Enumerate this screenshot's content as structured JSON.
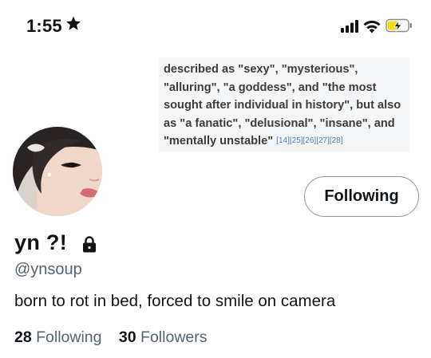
{
  "status_bar": {
    "time": "1:55",
    "icons": [
      "star-icon",
      "cellular-signal-icon",
      "wifi-icon",
      "battery-charging-icon"
    ],
    "battery_color": "#f5d90a"
  },
  "banner": {
    "text": "described as \"sexy\", \"mysterious\", \"alluring\", \"a goddess\", and \"the most sought after individual in history\", but also as \"a fanatic\", \"delusional\", \"insane\", and \"mentally unstable\"",
    "references": "[14][25][26][27][28]"
  },
  "profile": {
    "display_name": "yn ?!",
    "handle": "@ynsoup",
    "bio": "born to rot in bed, forced to smile on camera",
    "follow_button_label": "Following",
    "following_count": "28",
    "following_label": "Following",
    "followers_count": "30",
    "followers_label": "Followers"
  },
  "colors": {
    "text_primary": "#0f1419",
    "text_secondary": "#536471",
    "button_border": "#8b959e",
    "reference_link": "#4a7fc1"
  }
}
